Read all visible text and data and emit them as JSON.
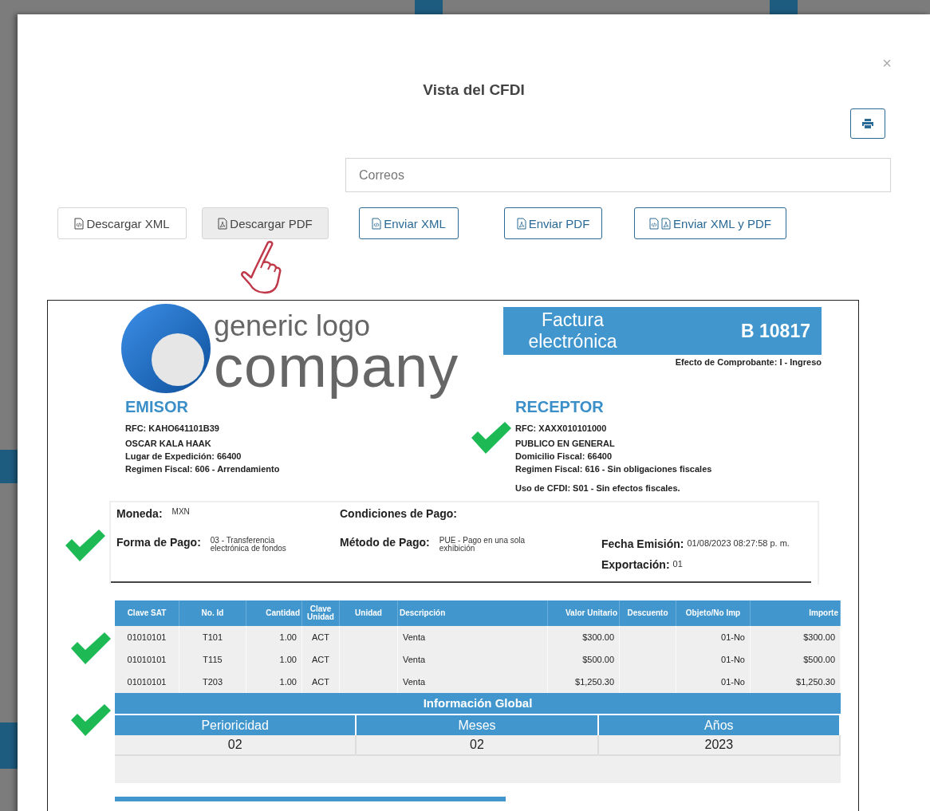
{
  "modal": {
    "title": "Vista del CFDI",
    "close": "×"
  },
  "email_field": {
    "placeholder": "Correos"
  },
  "buttons": [
    {
      "label": "Descargar XML",
      "kind": "download",
      "icons": [
        {
          "kind": "xml"
        }
      ],
      "hovered": false
    },
    {
      "label": "Descargar PDF",
      "kind": "download",
      "icons": [
        {
          "kind": "pdf"
        }
      ],
      "hovered": true
    },
    {
      "label": "Enviar XML",
      "kind": "send",
      "icons": [
        {
          "kind": "xml"
        }
      ],
      "hovered": false
    },
    {
      "label": "Enviar PDF",
      "kind": "send",
      "icons": [
        {
          "kind": "pdf"
        }
      ],
      "hovered": false
    },
    {
      "label": "Enviar XML y PDF",
      "kind": "send",
      "icons": [
        {
          "kind": "xml"
        },
        {
          "kind": "pdf"
        }
      ],
      "hovered": false
    }
  ],
  "document": {
    "logo": {
      "line1": "generic logo",
      "line2": "company"
    },
    "title": "Factura electrónica",
    "folio": "B 10817",
    "effect": "Efecto de Comprobante: I - Ingreso",
    "emisor": {
      "heading": "EMISOR",
      "checked": false,
      "lines": [
        "RFC: KAHO641101B39",
        "OSCAR KALA HAAK",
        "Lugar de Expedición: 66400",
        "Regimen Fiscal: 606 - Arrendamiento"
      ]
    },
    "receptor": {
      "heading": "RECEPTOR",
      "checked": true,
      "lines": [
        "RFC: XAXX010101000",
        "PUBLICO EN GENERAL",
        "Domicilio Fiscal: 66400",
        "Regimen Fiscal: 616 - Sin obligaciones fiscales",
        "Uso de CFDI: S01 - Sin efectos fiscales."
      ]
    },
    "payment": {
      "checked": true,
      "moneda": {
        "label": "Moneda:",
        "value": "MXN"
      },
      "condiciones": {
        "label": "Condiciones de Pago:"
      },
      "forma": {
        "label": "Forma de Pago:",
        "value": "03 - Transferencia electrónica de fondos"
      },
      "metodo": {
        "label": "Método de Pago:",
        "value": "PUE - Pago en una sola exhibición"
      },
      "fecha": {
        "label": "Fecha Emisión:",
        "value": "01/08/2023 08:27:58 p. m."
      },
      "exportacion": {
        "label": "Exportación:",
        "value": "01"
      }
    },
    "items_table": {
      "checked": true,
      "columns": [
        "Clave SAT",
        "No. Id",
        "Cantidad",
        "Clave Unidad",
        "Unidad",
        "Descripción",
        "Valor Unitario",
        "Descuento",
        "Objeto/No Imp",
        "Importe"
      ],
      "rows": [
        [
          "01010101",
          "T101",
          "1.00",
          "ACT",
          "",
          "Venta",
          "$300.00",
          "",
          "01-No",
          "$300.00"
        ],
        [
          "01010101",
          "T115",
          "1.00",
          "ACT",
          "",
          "Venta",
          "$500.00",
          "",
          "01-No",
          "$500.00"
        ],
        [
          "01010101",
          "T203",
          "1.00",
          "ACT",
          "",
          "Venta",
          "$1,250.30",
          "",
          "01-No",
          "$1,250.30"
        ]
      ]
    },
    "global_info": {
      "checked": true,
      "title": "Información Global",
      "columns": [
        "Perioricidad",
        "Meses",
        "Años"
      ],
      "values": [
        "02",
        "02",
        "2023"
      ]
    }
  }
}
